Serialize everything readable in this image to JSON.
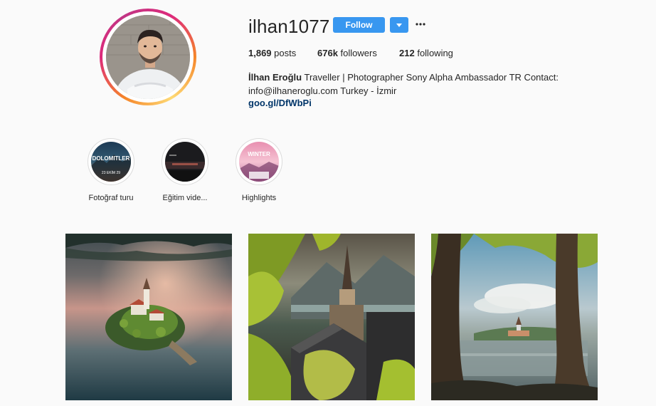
{
  "profile": {
    "username": "ilhan1077",
    "follow_label": "Follow",
    "dropdown_icon": "caret-down-icon",
    "more_icon": "ellipsis-icon",
    "stats": {
      "posts_count": "1,869",
      "posts_label": "posts",
      "followers_count": "676k",
      "followers_label": "followers",
      "following_count": "212",
      "following_label": "following"
    },
    "bio": {
      "name": "İlhan Eroğlu",
      "text": "Traveller | Photographer Sony Alpha Ambassador TR Contact: info@ilhaneroglu.com Turkey - İzmir",
      "link": "goo.gl/DfWbPi"
    }
  },
  "highlights": [
    {
      "label": "Fotoğraf turu",
      "cover_lines": [
        "DOLOMITLER",
        "23 EKİM 29"
      ]
    },
    {
      "label": "Eğitim vide..."
    },
    {
      "label": "Highlights",
      "cover_lines": [
        "WINTER"
      ]
    }
  ],
  "colors": {
    "accent": "#3897f0",
    "link": "#003569",
    "background": "#fafafa",
    "text": "#262626"
  }
}
